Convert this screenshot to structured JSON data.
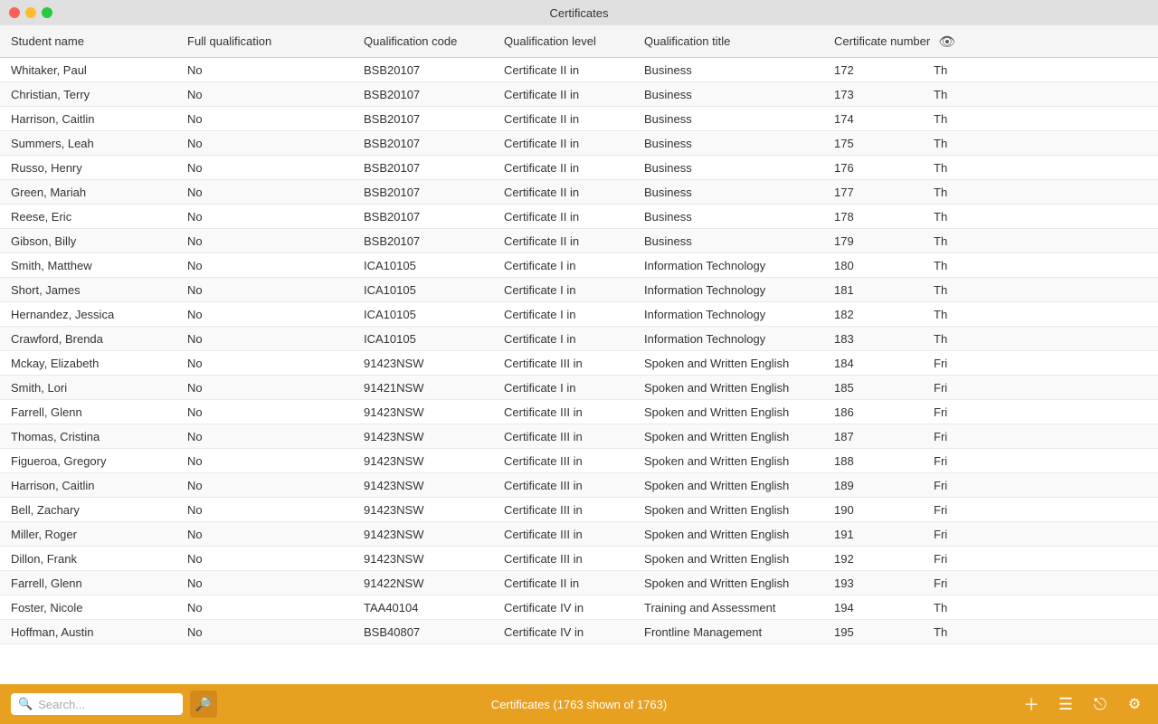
{
  "titleBar": {
    "title": "Certificates"
  },
  "columns": [
    {
      "key": "student",
      "label": "Student name",
      "class": "col-student"
    },
    {
      "key": "full",
      "label": "Full qualification",
      "class": "col-full"
    },
    {
      "key": "code",
      "label": "Qualification code",
      "class": "col-code"
    },
    {
      "key": "level",
      "label": "Qualification level",
      "class": "col-level"
    },
    {
      "key": "title",
      "label": "Qualification title",
      "class": "col-title"
    },
    {
      "key": "number",
      "label": "Certificate number",
      "class": "col-number"
    }
  ],
  "rows": [
    {
      "student": "Whitaker, Paul",
      "full": "No",
      "code": "BSB20107",
      "level": "Certificate II in",
      "title": "Business",
      "number": "172",
      "extra": "Th"
    },
    {
      "student": "Christian, Terry",
      "full": "No",
      "code": "BSB20107",
      "level": "Certificate II in",
      "title": "Business",
      "number": "173",
      "extra": "Th"
    },
    {
      "student": "Harrison, Caitlin",
      "full": "No",
      "code": "BSB20107",
      "level": "Certificate II in",
      "title": "Business",
      "number": "174",
      "extra": "Th"
    },
    {
      "student": "Summers, Leah",
      "full": "No",
      "code": "BSB20107",
      "level": "Certificate II in",
      "title": "Business",
      "number": "175",
      "extra": "Th"
    },
    {
      "student": "Russo, Henry",
      "full": "No",
      "code": "BSB20107",
      "level": "Certificate II in",
      "title": "Business",
      "number": "176",
      "extra": "Th"
    },
    {
      "student": "Green, Mariah",
      "full": "No",
      "code": "BSB20107",
      "level": "Certificate II in",
      "title": "Business",
      "number": "177",
      "extra": "Th"
    },
    {
      "student": "Reese, Eric",
      "full": "No",
      "code": "BSB20107",
      "level": "Certificate II in",
      "title": "Business",
      "number": "178",
      "extra": "Th"
    },
    {
      "student": "Gibson, Billy",
      "full": "No",
      "code": "BSB20107",
      "level": "Certificate II in",
      "title": "Business",
      "number": "179",
      "extra": "Th"
    },
    {
      "student": "Smith, Matthew",
      "full": "No",
      "code": "ICA10105",
      "level": "Certificate I in",
      "title": "Information Technology",
      "number": "180",
      "extra": "Th"
    },
    {
      "student": "Short, James",
      "full": "No",
      "code": "ICA10105",
      "level": "Certificate I in",
      "title": "Information Technology",
      "number": "181",
      "extra": "Th"
    },
    {
      "student": "Hernandez, Jessica",
      "full": "No",
      "code": "ICA10105",
      "level": "Certificate I in",
      "title": "Information Technology",
      "number": "182",
      "extra": "Th"
    },
    {
      "student": "Crawford, Brenda",
      "full": "No",
      "code": "ICA10105",
      "level": "Certificate I in",
      "title": "Information Technology",
      "number": "183",
      "extra": "Th"
    },
    {
      "student": "Mckay, Elizabeth",
      "full": "No",
      "code": "91423NSW",
      "level": "Certificate III in",
      "title": "Spoken and Written English",
      "number": "184",
      "extra": "Fri"
    },
    {
      "student": "Smith, Lori",
      "full": "No",
      "code": "91421NSW",
      "level": "Certificate I in",
      "title": "Spoken and Written English",
      "number": "185",
      "extra": "Fri"
    },
    {
      "student": "Farrell, Glenn",
      "full": "No",
      "code": "91423NSW",
      "level": "Certificate III in",
      "title": "Spoken and Written English",
      "number": "186",
      "extra": "Fri"
    },
    {
      "student": "Thomas, Cristina",
      "full": "No",
      "code": "91423NSW",
      "level": "Certificate III in",
      "title": "Spoken and Written English",
      "number": "187",
      "extra": "Fri"
    },
    {
      "student": "Figueroa, Gregory",
      "full": "No",
      "code": "91423NSW",
      "level": "Certificate III in",
      "title": "Spoken and Written English",
      "number": "188",
      "extra": "Fri"
    },
    {
      "student": "Harrison, Caitlin",
      "full": "No",
      "code": "91423NSW",
      "level": "Certificate III in",
      "title": "Spoken and Written English",
      "number": "189",
      "extra": "Fri"
    },
    {
      "student": "Bell, Zachary",
      "full": "No",
      "code": "91423NSW",
      "level": "Certificate III in",
      "title": "Spoken and Written English",
      "number": "190",
      "extra": "Fri"
    },
    {
      "student": "Miller, Roger",
      "full": "No",
      "code": "91423NSW",
      "level": "Certificate III in",
      "title": "Spoken and Written English",
      "number": "191",
      "extra": "Fri"
    },
    {
      "student": "Dillon, Frank",
      "full": "No",
      "code": "91423NSW",
      "level": "Certificate III in",
      "title": "Spoken and Written English",
      "number": "192",
      "extra": "Fri"
    },
    {
      "student": "Farrell, Glenn",
      "full": "No",
      "code": "91422NSW",
      "level": "Certificate II in",
      "title": "Spoken and Written English",
      "number": "193",
      "extra": "Fri"
    },
    {
      "student": "Foster, Nicole",
      "full": "No",
      "code": "TAA40104",
      "level": "Certificate IV in",
      "title": "Training and Assessment",
      "number": "194",
      "extra": "Th"
    },
    {
      "student": "Hoffman, Austin",
      "full": "No",
      "code": "BSB40807",
      "level": "Certificate IV in",
      "title": "Frontline Management",
      "number": "195",
      "extra": "Th"
    }
  ],
  "bottomBar": {
    "searchPlaceholder": "Search...",
    "statusText": "Certificates (1763 shown of 1763)"
  }
}
